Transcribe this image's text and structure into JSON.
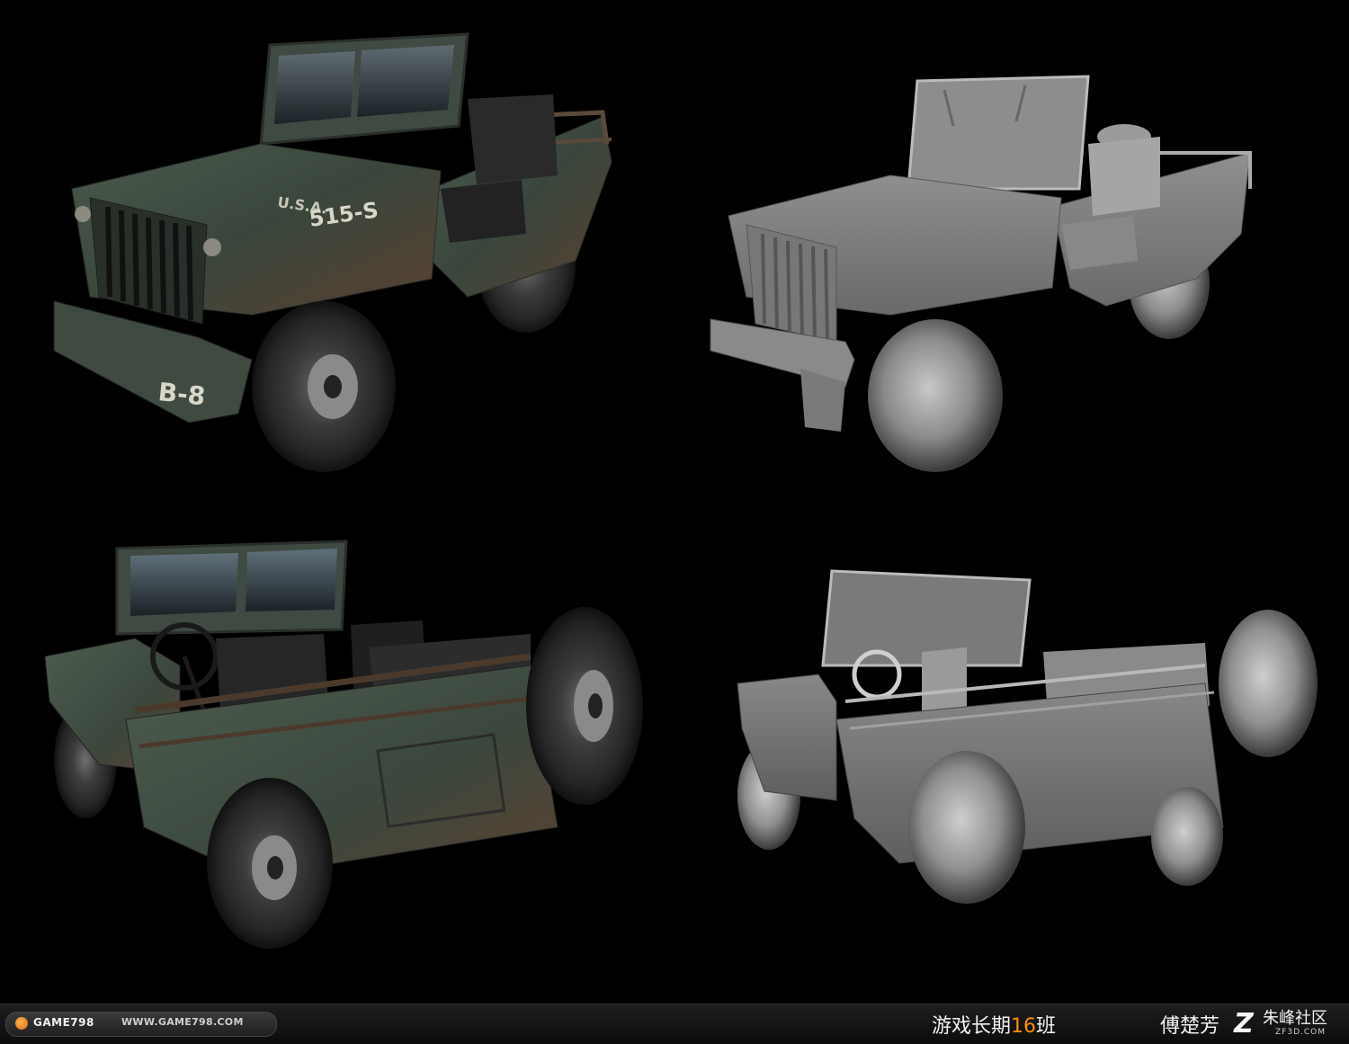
{
  "renders": [
    {
      "id": "textured-front",
      "markings": [
        "U.S.A.",
        "515-S",
        "B-8"
      ]
    },
    {
      "id": "untextured-front"
    },
    {
      "id": "textured-rear"
    },
    {
      "id": "untextured-rear"
    }
  ],
  "footer": {
    "brand": "GAME798",
    "url": "WWW.GAME798.COM",
    "course_prefix": "游戏长期",
    "course_number": "16",
    "course_suffix": "班",
    "author": "傅楚芳",
    "logo_letter": "Z",
    "community": "朱峰社区",
    "community_url": "ZF3D.COM"
  },
  "colors": {
    "background": "#000000",
    "jeep_textured": "#3d4a3f",
    "jeep_rust": "#7a4a2a",
    "jeep_untextured": "#8c8c8c",
    "accent": "#ff8c00"
  }
}
